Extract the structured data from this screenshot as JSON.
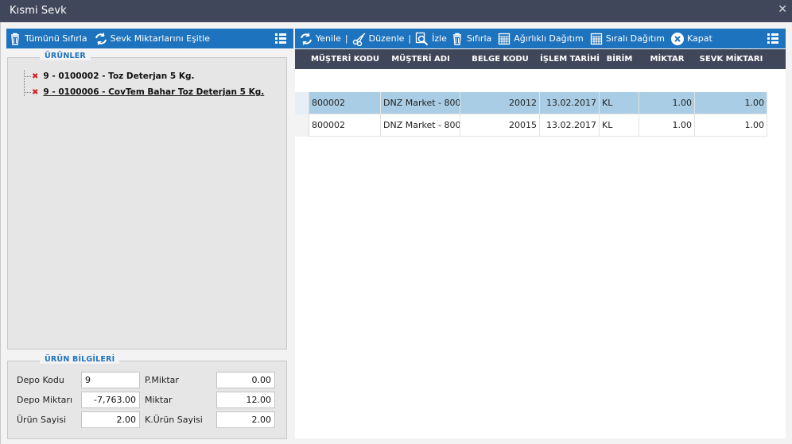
{
  "window": {
    "title": "Kısmi Sevk",
    "close_icon": "✕"
  },
  "left_toolbar": {
    "reset_all_label": "Tümünü Sıfırla",
    "equalize_label": "Sevk Miktarlarını Eşitle"
  },
  "right_toolbar": {
    "refresh_label": "Yenile",
    "edit_label": "Düzenle",
    "watch_label": "İzle",
    "reset_label": "Sıfırla",
    "weighted_label": "Ağırlıklı Dağıtım",
    "sequential_label": "Sıralı Dağıtım",
    "close_label": "Kapat",
    "separator": "|"
  },
  "products": {
    "legend": "ÜRÜNLER",
    "items": [
      {
        "label": "9 - 0100002 - Toz Deterjan 5 Kg.",
        "icon": "remove-icon"
      },
      {
        "label": "9 - 0100006 - CovTem Bahar Toz Deterjan 5 Kg.",
        "icon": "remove-icon"
      }
    ]
  },
  "product_info": {
    "legend": "ÜRÜN BİLGİLERİ",
    "depo_kodu_label": "Depo Kodu",
    "depo_kodu_value": "9",
    "depo_miktari_label": "Depo Miktarı",
    "depo_miktari_value": "-7,763.00",
    "urun_sayisi_label": "Ürün Sayisi",
    "urun_sayisi_value": "2.00",
    "p_miktar_label": "P.Miktar",
    "p_miktar_value": "0.00",
    "miktar_label": "Miktar",
    "miktar_value": "12.00",
    "k_urun_sayisi_label": "K.Ürün Sayisi",
    "k_urun_sayisi_value": "2.00"
  },
  "grid": {
    "columns": [
      "MÜŞTERİ KODU",
      "MÜŞTERİ ADI",
      "BELGE KODU",
      "İŞLEM TARİHİ",
      "BİRİM",
      "MİKTAR",
      "SEVK MİKTARI"
    ],
    "rows": [
      [
        "800002",
        "DNZ Market - 800...",
        "20012",
        "13.02.2017",
        "KL",
        "1.00",
        "1.00"
      ],
      [
        "800002",
        "DNZ Market - 800...",
        "20015",
        "13.02.2017",
        "KL",
        "1.00",
        "1.00"
      ]
    ]
  },
  "colors": {
    "toolbar": "#1e73be",
    "titlebar": "#41475a",
    "selection": "#a9cde4",
    "remove": "#d32020"
  }
}
